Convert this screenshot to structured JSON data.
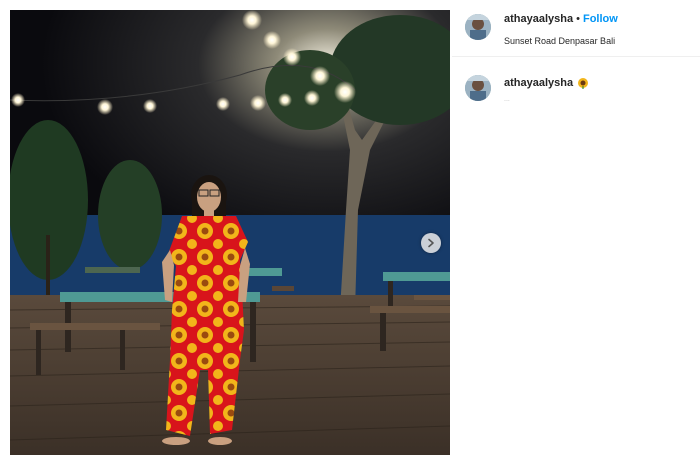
{
  "post": {
    "username": "athayaalysha",
    "follow_label": "Follow",
    "separator": "•",
    "location": "Sunset Road Denpasar Bali"
  },
  "caption": {
    "username": "athayaalysha",
    "emoji_icon": "sunflower-icon",
    "meta": "..."
  },
  "controls": {
    "next_icon": "chevron-right-icon"
  },
  "colors": {
    "follow": "#0095f6",
    "text": "#262626",
    "jumpsuit": "#d8141b",
    "sunflower": "#f2b51a",
    "wall": "#1f4f8c"
  }
}
